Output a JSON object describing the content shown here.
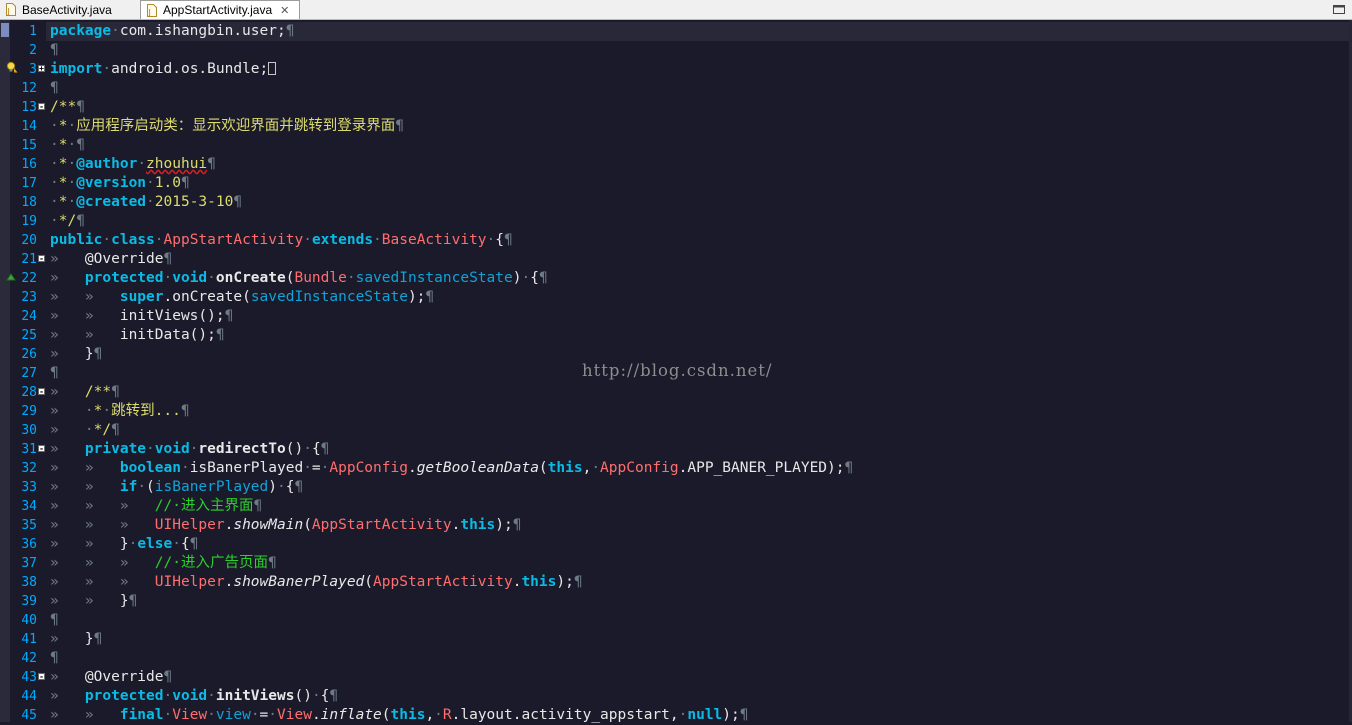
{
  "tabs": [
    {
      "label": "BaseActivity.java",
      "active": false
    },
    {
      "label": "AppStartActivity.java",
      "active": true
    }
  ],
  "tab_close_symbol": "✕",
  "watermark": "http://blog.csdn.net/",
  "colors": {
    "keyword": "#0abbe5",
    "type": "#ff6e6e",
    "parameter": "#0fa3d8",
    "doc_comment": "#dcdc6e",
    "line_comment": "#2ccf2c",
    "whitespace_marker": "#6e7a86",
    "line_number": "#00aaff",
    "background": "#1b1a2a"
  },
  "icons": {
    "file_icon": "java-file-icon",
    "fold": "fold-toggle-icon",
    "override": "override-marker-icon",
    "warning": "warning-lightbulb-icon",
    "maximize": "maximize-icon"
  },
  "editor": {
    "lines": [
      {
        "num": "1",
        "fold": "",
        "tokens": [
          [
            "kw",
            "package"
          ],
          [
            "ws",
            "·"
          ],
          [
            "p",
            "com.ishangbin.user;"
          ],
          [
            "ws",
            "¶"
          ]
        ]
      },
      {
        "num": "2",
        "fold": "",
        "tokens": [
          [
            "ws",
            "¶"
          ]
        ]
      },
      {
        "num": "3",
        "fold": "+",
        "tokens": [
          [
            "kw",
            "import"
          ],
          [
            "ws",
            "·"
          ],
          [
            "p",
            "android.os.Bundle;"
          ],
          [
            "cursor",
            ""
          ]
        ]
      },
      {
        "num": "12",
        "fold": "",
        "tokens": [
          [
            "ws",
            "¶"
          ]
        ]
      },
      {
        "num": "13",
        "fold": "-",
        "tokens": [
          [
            "doc",
            "/**"
          ],
          [
            "ws",
            "¶"
          ]
        ]
      },
      {
        "num": "14",
        "fold": "",
        "tokens": [
          [
            "ws",
            "·"
          ],
          [
            "doc",
            "*"
          ],
          [
            "ws",
            "·"
          ],
          [
            "doc",
            "应用程序启动类：显示欢迎界面并跳转到登录界面"
          ],
          [
            "ws",
            "¶"
          ]
        ]
      },
      {
        "num": "15",
        "fold": "",
        "tokens": [
          [
            "ws",
            "·"
          ],
          [
            "doc",
            "*"
          ],
          [
            "ws",
            "·¶"
          ]
        ]
      },
      {
        "num": "16",
        "fold": "",
        "tokens": [
          [
            "ws",
            "·"
          ],
          [
            "doc",
            "*"
          ],
          [
            "ws",
            "·"
          ],
          [
            "tag",
            "@author"
          ],
          [
            "ws",
            "·"
          ],
          [
            "author",
            "zhouhui"
          ],
          [
            "ws",
            "¶"
          ]
        ]
      },
      {
        "num": "17",
        "fold": "",
        "tokens": [
          [
            "ws",
            "·"
          ],
          [
            "doc",
            "*"
          ],
          [
            "ws",
            "·"
          ],
          [
            "tag",
            "@version"
          ],
          [
            "ws",
            "·"
          ],
          [
            "doc",
            "1.0"
          ],
          [
            "ws",
            "¶"
          ]
        ]
      },
      {
        "num": "18",
        "fold": "",
        "tokens": [
          [
            "ws",
            "·"
          ],
          [
            "doc",
            "*"
          ],
          [
            "ws",
            "·"
          ],
          [
            "tag",
            "@created"
          ],
          [
            "ws",
            "·"
          ],
          [
            "doc",
            "2015-3-10"
          ],
          [
            "ws",
            "¶"
          ]
        ]
      },
      {
        "num": "19",
        "fold": "",
        "tokens": [
          [
            "ws",
            "·"
          ],
          [
            "doc",
            "*/"
          ],
          [
            "ws",
            "¶"
          ]
        ]
      },
      {
        "num": "20",
        "fold": "",
        "tokens": [
          [
            "kw",
            "public"
          ],
          [
            "ws",
            "·"
          ],
          [
            "kw",
            "class"
          ],
          [
            "ws",
            "·"
          ],
          [
            "type",
            "AppStartActivity"
          ],
          [
            "ws",
            "·"
          ],
          [
            "kw",
            "extends"
          ],
          [
            "ws",
            "·"
          ],
          [
            "type",
            "BaseActivity"
          ],
          [
            "ws",
            "·"
          ],
          [
            "p",
            "{"
          ],
          [
            "ws",
            "¶"
          ]
        ]
      },
      {
        "num": "21",
        "fold": "-",
        "tokens": [
          [
            "ws",
            "»   "
          ],
          [
            "p",
            "@Override"
          ],
          [
            "ws",
            "¶"
          ]
        ]
      },
      {
        "num": "22",
        "fold": "",
        "tokens": [
          [
            "ws",
            "»   "
          ],
          [
            "kw",
            "protected"
          ],
          [
            "ws",
            "·"
          ],
          [
            "kw",
            "void"
          ],
          [
            "ws",
            "·"
          ],
          [
            "pb",
            "onCreate"
          ],
          [
            "p",
            "("
          ],
          [
            "type",
            "Bundle"
          ],
          [
            "ws",
            "·"
          ],
          [
            "param",
            "savedInstanceState"
          ],
          [
            "p",
            ")"
          ],
          [
            "ws",
            "·"
          ],
          [
            "p",
            "{"
          ],
          [
            "ws",
            "¶"
          ]
        ]
      },
      {
        "num": "23",
        "fold": "",
        "tokens": [
          [
            "ws",
            "»   »   "
          ],
          [
            "kw",
            "super"
          ],
          [
            "p",
            ".onCreate("
          ],
          [
            "param",
            "savedInstanceState"
          ],
          [
            "p",
            ");"
          ],
          [
            "ws",
            "¶"
          ]
        ]
      },
      {
        "num": "24",
        "fold": "",
        "tokens": [
          [
            "ws",
            "»   »   "
          ],
          [
            "p",
            "initViews();"
          ],
          [
            "ws",
            "¶"
          ]
        ]
      },
      {
        "num": "25",
        "fold": "",
        "tokens": [
          [
            "ws",
            "»   »   "
          ],
          [
            "p",
            "initData();"
          ],
          [
            "ws",
            "¶"
          ]
        ]
      },
      {
        "num": "26",
        "fold": "",
        "tokens": [
          [
            "ws",
            "»   "
          ],
          [
            "p",
            "}"
          ],
          [
            "ws",
            "¶"
          ]
        ]
      },
      {
        "num": "27",
        "fold": "",
        "tokens": [
          [
            "ws",
            "¶"
          ]
        ]
      },
      {
        "num": "28",
        "fold": "-",
        "tokens": [
          [
            "ws",
            "»   "
          ],
          [
            "doc",
            "/**"
          ],
          [
            "ws",
            "¶"
          ]
        ]
      },
      {
        "num": "29",
        "fold": "",
        "tokens": [
          [
            "ws",
            "»   ·"
          ],
          [
            "doc",
            "*"
          ],
          [
            "ws",
            "·"
          ],
          [
            "doc",
            "跳转到..."
          ],
          [
            "ws",
            "¶"
          ]
        ]
      },
      {
        "num": "30",
        "fold": "",
        "tokens": [
          [
            "ws",
            "»   ·"
          ],
          [
            "doc",
            "*/"
          ],
          [
            "ws",
            "¶"
          ]
        ]
      },
      {
        "num": "31",
        "fold": "-",
        "tokens": [
          [
            "ws",
            "»   "
          ],
          [
            "kw",
            "private"
          ],
          [
            "ws",
            "·"
          ],
          [
            "kw",
            "void"
          ],
          [
            "ws",
            "·"
          ],
          [
            "pb",
            "redirectTo"
          ],
          [
            "p",
            "()"
          ],
          [
            "ws",
            "·"
          ],
          [
            "p",
            "{"
          ],
          [
            "ws",
            "¶"
          ]
        ]
      },
      {
        "num": "32",
        "fold": "",
        "tokens": [
          [
            "ws",
            "»   »   "
          ],
          [
            "kw",
            "boolean"
          ],
          [
            "ws",
            "·"
          ],
          [
            "p",
            "isBanerPlayed"
          ],
          [
            "ws",
            "·"
          ],
          [
            "p",
            "="
          ],
          [
            "ws",
            "·"
          ],
          [
            "type",
            "AppConfig"
          ],
          [
            "p",
            "."
          ],
          [
            "it",
            "getBooleanData"
          ],
          [
            "p",
            "("
          ],
          [
            "kw",
            "this"
          ],
          [
            "p",
            ","
          ],
          [
            "ws",
            "·"
          ],
          [
            "type",
            "AppConfig"
          ],
          [
            "p",
            ".APP_BANER_PLAYED);"
          ],
          [
            "ws",
            "¶"
          ]
        ]
      },
      {
        "num": "33",
        "fold": "",
        "tokens": [
          [
            "ws",
            "»   »   "
          ],
          [
            "kw",
            "if"
          ],
          [
            "ws",
            "·"
          ],
          [
            "p",
            "("
          ],
          [
            "param",
            "isBanerPlayed"
          ],
          [
            "p",
            ")"
          ],
          [
            "ws",
            "·"
          ],
          [
            "p",
            "{"
          ],
          [
            "ws",
            "¶"
          ]
        ]
      },
      {
        "num": "34",
        "fold": "",
        "tokens": [
          [
            "ws",
            "»   »   »   "
          ],
          [
            "comment",
            "//·进入主界面"
          ],
          [
            "ws",
            "¶"
          ]
        ]
      },
      {
        "num": "35",
        "fold": "",
        "tokens": [
          [
            "ws",
            "»   »   »   "
          ],
          [
            "type",
            "UIHelper"
          ],
          [
            "p",
            "."
          ],
          [
            "it",
            "showMain"
          ],
          [
            "p",
            "("
          ],
          [
            "type",
            "AppStartActivity"
          ],
          [
            "p",
            "."
          ],
          [
            "kw",
            "this"
          ],
          [
            "p",
            ");"
          ],
          [
            "ws",
            "¶"
          ]
        ]
      },
      {
        "num": "36",
        "fold": "",
        "tokens": [
          [
            "ws",
            "»   »   "
          ],
          [
            "p",
            "}"
          ],
          [
            "ws",
            "·"
          ],
          [
            "kw",
            "else"
          ],
          [
            "ws",
            "·"
          ],
          [
            "p",
            "{"
          ],
          [
            "ws",
            "¶"
          ]
        ]
      },
      {
        "num": "37",
        "fold": "",
        "tokens": [
          [
            "ws",
            "»   »   »   "
          ],
          [
            "comment",
            "//·进入广告页面"
          ],
          [
            "ws",
            "¶"
          ]
        ]
      },
      {
        "num": "38",
        "fold": "",
        "tokens": [
          [
            "ws",
            "»   »   »   "
          ],
          [
            "type",
            "UIHelper"
          ],
          [
            "p",
            "."
          ],
          [
            "it",
            "showBanerPlayed"
          ],
          [
            "p",
            "("
          ],
          [
            "type",
            "AppStartActivity"
          ],
          [
            "p",
            "."
          ],
          [
            "kw",
            "this"
          ],
          [
            "p",
            ");"
          ],
          [
            "ws",
            "¶"
          ]
        ]
      },
      {
        "num": "39",
        "fold": "",
        "tokens": [
          [
            "ws",
            "»   »   "
          ],
          [
            "p",
            "}"
          ],
          [
            "ws",
            "¶"
          ]
        ]
      },
      {
        "num": "40",
        "fold": "",
        "tokens": [
          [
            "ws",
            "¶"
          ]
        ]
      },
      {
        "num": "41",
        "fold": "",
        "tokens": [
          [
            "ws",
            "»   "
          ],
          [
            "p",
            "}"
          ],
          [
            "ws",
            "¶"
          ]
        ]
      },
      {
        "num": "42",
        "fold": "",
        "tokens": [
          [
            "ws",
            "¶"
          ]
        ]
      },
      {
        "num": "43",
        "fold": "-",
        "tokens": [
          [
            "ws",
            "»   "
          ],
          [
            "p",
            "@Override"
          ],
          [
            "ws",
            "¶"
          ]
        ]
      },
      {
        "num": "44",
        "fold": "",
        "tokens": [
          [
            "ws",
            "»   "
          ],
          [
            "kw",
            "protected"
          ],
          [
            "ws",
            "·"
          ],
          [
            "kw",
            "void"
          ],
          [
            "ws",
            "·"
          ],
          [
            "pb",
            "initViews"
          ],
          [
            "p",
            "()"
          ],
          [
            "ws",
            "·"
          ],
          [
            "p",
            "{"
          ],
          [
            "ws",
            "¶"
          ]
        ]
      },
      {
        "num": "45",
        "fold": "",
        "tokens": [
          [
            "ws",
            "»   »   "
          ],
          [
            "kw",
            "final"
          ],
          [
            "ws",
            "·"
          ],
          [
            "type",
            "View"
          ],
          [
            "ws",
            "·"
          ],
          [
            "param",
            "view"
          ],
          [
            "ws",
            "·"
          ],
          [
            "p",
            "="
          ],
          [
            "ws",
            "·"
          ],
          [
            "type",
            "View"
          ],
          [
            "p",
            "."
          ],
          [
            "it",
            "inflate"
          ],
          [
            "p",
            "("
          ],
          [
            "kw",
            "this"
          ],
          [
            "p",
            ","
          ],
          [
            "ws",
            "·"
          ],
          [
            "type",
            "R"
          ],
          [
            "p",
            ".layout.activity_appstart,"
          ],
          [
            "ws",
            "·"
          ],
          [
            "kw",
            "null"
          ],
          [
            "p",
            ");"
          ],
          [
            "ws",
            "¶"
          ]
        ]
      }
    ]
  }
}
